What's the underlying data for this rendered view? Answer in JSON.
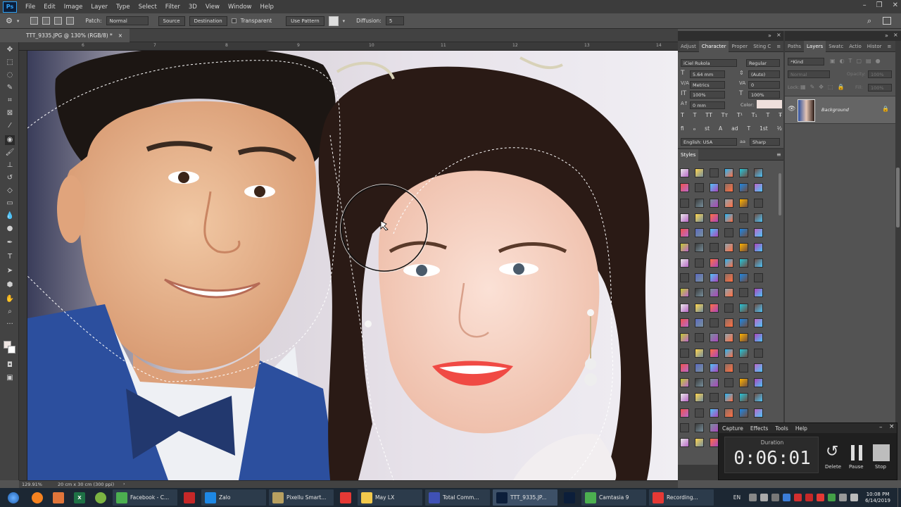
{
  "app": {
    "logo": "Ps"
  },
  "menu": [
    "File",
    "Edit",
    "Image",
    "Layer",
    "Type",
    "Select",
    "Filter",
    "3D",
    "View",
    "Window",
    "Help"
  ],
  "window_controls": [
    "–",
    "❐",
    "✕"
  ],
  "options": {
    "patch_label": "Patch:",
    "patch_mode": "Normal",
    "source_label": "Source",
    "destination_label": "Destination",
    "transparent_label": "Transparent",
    "use_pattern_label": "Use Pattern",
    "diffusion_label": "Diffusion:",
    "diffusion_value": "5"
  },
  "document": {
    "tab_title": "TTT_9335.JPG @ 130% (RGB/8) *",
    "close": "×",
    "zoom": "129.91%",
    "size_info": "20 cm x 30 cm (300 ppi)"
  },
  "ruler": {
    "h_ticks": [
      "6",
      "7",
      "8",
      "9",
      "10",
      "11",
      "12",
      "13",
      "14"
    ]
  },
  "character_panel": {
    "tabs": [
      "Adjust",
      "Character",
      "Proper",
      "Sting C"
    ],
    "font_family": "iCiel Rukola",
    "font_style": "Regular",
    "font_size": "5.64 mm",
    "leading": "(Auto)",
    "kerning": "Metrics",
    "tracking": "0",
    "vscale": "100%",
    "hscale": "100%",
    "baseline": "0 mm",
    "color_label": "Color:",
    "type_buttons": [
      "T",
      "T",
      "TT",
      "Tт",
      "T¹",
      "T₁",
      "T",
      "Ŧ"
    ],
    "opentype_buttons": [
      "fi",
      "ℴ",
      "st",
      "A",
      "ad",
      "T",
      "1st",
      "½"
    ],
    "language": "English: USA",
    "aa_label": "aa",
    "antialias": "Sharp"
  },
  "styles_panel": {
    "title": "Styles"
  },
  "layers_panel": {
    "tabs": [
      "Paths",
      "Layers",
      "Swatc",
      "Actio",
      "Histor"
    ],
    "kind_placeholder": "Kind",
    "blend_mode": "Normal",
    "opacity_label": "Opacity:",
    "opacity_value": "100%",
    "lock_label": "Lock:",
    "fill_label": "Fill:",
    "fill_value": "100%",
    "layer_name": "Background"
  },
  "camtasia_recorder": {
    "menu": [
      "Capture",
      "Effects",
      "Tools",
      "Help"
    ],
    "duration_label": "Duration",
    "duration": "0:06:01",
    "delete_label": "Delete",
    "pause_label": "Pause",
    "stop_label": "Stop"
  },
  "taskbar": {
    "items": [
      {
        "label": "Facebook - C...",
        "icon": "chrome-green-icon",
        "color": "#4caf50"
      },
      {
        "label": "",
        "icon": "camera-icon",
        "color": "#c62828"
      },
      {
        "label": "Zalo",
        "icon": "zalo-icon",
        "color": "#1e88e5"
      },
      {
        "label": "Pixellu Smart...",
        "icon": "smartalbums-icon",
        "color": "#b8a060"
      },
      {
        "label": "",
        "icon": "chrome-icon",
        "color": "#e53935"
      },
      {
        "label": "May LX",
        "icon": "folder-icon",
        "color": "#f2c94c"
      },
      {
        "label": "Total Comm...",
        "icon": "floppy-icon",
        "color": "#3f51b5"
      },
      {
        "label": "TTT_9335.JP...",
        "icon": "photoshop-icon",
        "color": "#0c1e3a",
        "active": true
      },
      {
        "label": "",
        "icon": "photoshop-icon",
        "color": "#0c1e3a"
      },
      {
        "label": "Camtasia 9",
        "icon": "camtasia-icon",
        "color": "#4caf50"
      },
      {
        "label": "Recording...",
        "icon": "recorder-icon",
        "color": "#e53935"
      }
    ],
    "language": "EN",
    "time": "10:08 PM",
    "date": "6/14/2019"
  }
}
